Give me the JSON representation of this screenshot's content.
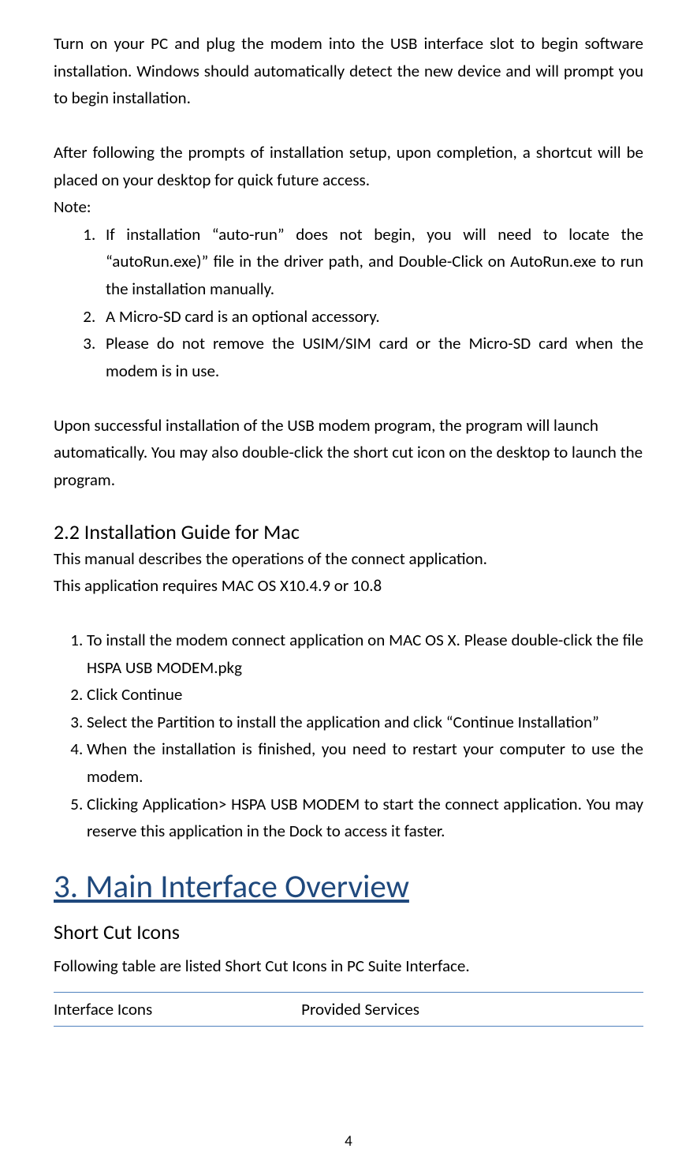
{
  "para1": "Turn on your PC and plug the modem into the USB interface slot to begin software installation. Windows should automatically detect the new device and will prompt you to begin installation.",
  "para2": "After following the prompts of installation setup, upon completion, a shortcut will be placed on your desktop for quick future access.",
  "note_label": "Note:",
  "notes": [
    "If installation “auto-run” does not begin, you will need to locate the “autoRun.exe)” file in the driver path, and Double-Click on AutoRun.exe to run the installation manually.",
    "A Micro-SD card is an optional accessory.",
    "Please do not remove the USIM/SIM card or the Micro-SD card when the modem is in use."
  ],
  "para3": "Upon successful installation of the USB modem program, the program will launch automatically. You may also double-click the short cut icon on the desktop to launch the program.",
  "heading_22": "2.2 Installation Guide for Mac",
  "mac_intro1": "This manual describes the operations of the connect application.",
  "mac_intro2": "This application requires MAC OS X10.4.9 or 10.8",
  "mac_steps": [
    "To install the modem connect application on MAC OS X. Please double-click the file HSPA USB MODEM.pkg",
    "Click Continue",
    "Select the Partition to install the application and click “Continue Installation”",
    "When the installation is finished, you need to restart your computer to use the modem.",
    "Clicking Application> HSPA USB MODEM to start the connect application. You may reserve this application in the Dock to access it faster."
  ],
  "heading_3": "3. Main Interface Overview",
  "heading_shortcut": "Short Cut Icons",
  "table_intro": "Following table are listed Short Cut Icons in PC Suite Interface.",
  "table_headers": {
    "col1": "Interface Icons",
    "col2": "Provided Services"
  },
  "page_number": "4"
}
